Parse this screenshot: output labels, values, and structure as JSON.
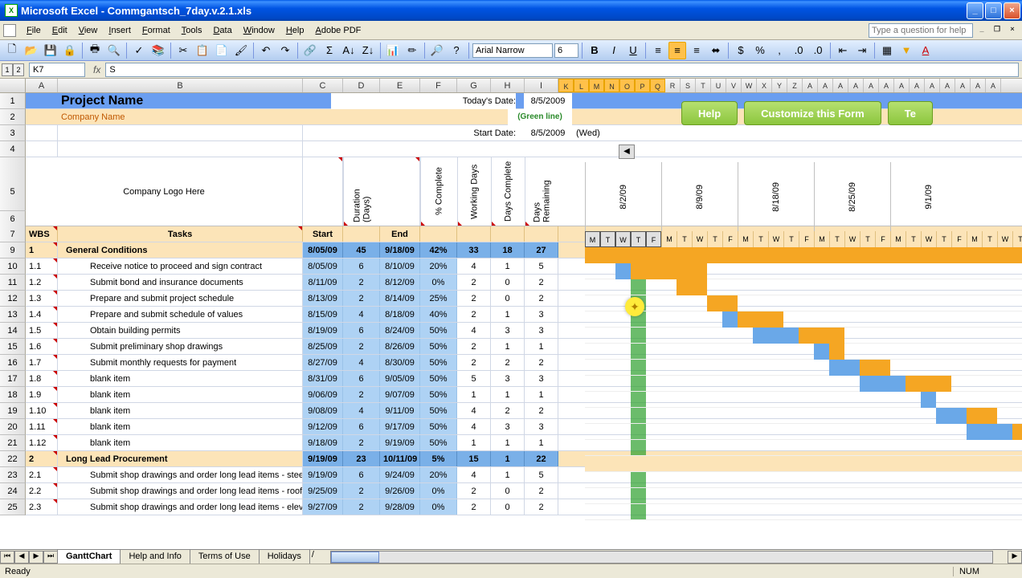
{
  "app": {
    "title": "Microsoft Excel - Commgantsch_7day.v.2.1.xls",
    "help_placeholder": "Type a question for help"
  },
  "menu": [
    "File",
    "Edit",
    "View",
    "Insert",
    "Format",
    "Tools",
    "Data",
    "Window",
    "Help",
    "Adobe PDF"
  ],
  "toolbar2": {
    "font_name": "Arial Narrow",
    "font_size": "6"
  },
  "namebar": {
    "outline": [
      "1",
      "2"
    ],
    "cell_ref": "K7",
    "formula": "S"
  },
  "col_letters_main": [
    "A",
    "B",
    "C",
    "D",
    "E",
    "F",
    "G",
    "H",
    "I"
  ],
  "col_letters_narrow": [
    "K",
    "L",
    "M",
    "N",
    "O",
    "P",
    "Q",
    "R",
    "S",
    "T",
    "U",
    "V",
    "W",
    "X",
    "Y",
    "Z",
    "A",
    "A",
    "A",
    "A",
    "A",
    "A",
    "A",
    "A",
    "A",
    "A",
    "A",
    "A",
    "A"
  ],
  "top": {
    "project": "Project Name",
    "company": "Company Name",
    "logo": "Company Logo Here",
    "today_lbl": "Today's Date:",
    "today": "8/5/2009",
    "green": "(Green line)",
    "start_lbl": "Start Date:",
    "start": "8/5/2009",
    "wed": "(Wed)"
  },
  "buttons": {
    "help": "Help",
    "customize": "Customize this Form",
    "te": "Te"
  },
  "cols": {
    "wbs": "WBS",
    "tasks": "Tasks",
    "start": "Start",
    "dur": "Duration (Days)",
    "end": "End",
    "pct": "% Complete",
    "wd": "Working Days",
    "dc": "Days Complete",
    "dr": "Days Remaining"
  },
  "week_dates": [
    "8/2/09",
    "8/9/09",
    "8/18/09",
    "8/25/09",
    "9/1/09"
  ],
  "dow": [
    "M",
    "T",
    "W",
    "T",
    "F"
  ],
  "rows": [
    {
      "n": 9,
      "g": true,
      "wbs": "1",
      "task": "General Conditions",
      "s": "8/05/09",
      "d": "45",
      "e": "9/18/09",
      "p": "42%",
      "wd": "33",
      "dc": "18",
      "dr": "27"
    },
    {
      "n": 10,
      "wbs": "1.1",
      "task": "Receive notice to proceed and sign contract",
      "s": "8/05/09",
      "d": "6",
      "e": "8/10/09",
      "p": "20%",
      "wd": "4",
      "dc": "1",
      "dr": "5"
    },
    {
      "n": 11,
      "wbs": "1.2",
      "task": "Submit bond and insurance documents",
      "s": "8/11/09",
      "d": "2",
      "e": "8/12/09",
      "p": "0%",
      "wd": "2",
      "dc": "0",
      "dr": "2"
    },
    {
      "n": 12,
      "wbs": "1.3",
      "task": "Prepare and submit project schedule",
      "s": "8/13/09",
      "d": "2",
      "e": "8/14/09",
      "p": "25%",
      "wd": "2",
      "dc": "0",
      "dr": "2"
    },
    {
      "n": 13,
      "wbs": "1.4",
      "task": "Prepare and submit schedule of values",
      "s": "8/15/09",
      "d": "4",
      "e": "8/18/09",
      "p": "40%",
      "wd": "2",
      "dc": "1",
      "dr": "3"
    },
    {
      "n": 14,
      "wbs": "1.5",
      "task": "Obtain building permits",
      "s": "8/19/09",
      "d": "6",
      "e": "8/24/09",
      "p": "50%",
      "wd": "4",
      "dc": "3",
      "dr": "3"
    },
    {
      "n": 15,
      "wbs": "1.6",
      "task": "Submit preliminary shop drawings",
      "s": "8/25/09",
      "d": "2",
      "e": "8/26/09",
      "p": "50%",
      "wd": "2",
      "dc": "1",
      "dr": "1"
    },
    {
      "n": 16,
      "wbs": "1.7",
      "task": "Submit monthly requests for payment",
      "s": "8/27/09",
      "d": "4",
      "e": "8/30/09",
      "p": "50%",
      "wd": "2",
      "dc": "2",
      "dr": "2"
    },
    {
      "n": 17,
      "wbs": "1.8",
      "task": "blank item",
      "s": "8/31/09",
      "d": "6",
      "e": "9/05/09",
      "p": "50%",
      "wd": "5",
      "dc": "3",
      "dr": "3"
    },
    {
      "n": 18,
      "wbs": "1.9",
      "task": "blank item",
      "s": "9/06/09",
      "d": "2",
      "e": "9/07/09",
      "p": "50%",
      "wd": "1",
      "dc": "1",
      "dr": "1"
    },
    {
      "n": 19,
      "wbs": "1.10",
      "task": "blank item",
      "s": "9/08/09",
      "d": "4",
      "e": "9/11/09",
      "p": "50%",
      "wd": "4",
      "dc": "2",
      "dr": "2"
    },
    {
      "n": 20,
      "wbs": "1.11",
      "task": "blank item",
      "s": "9/12/09",
      "d": "6",
      "e": "9/17/09",
      "p": "50%",
      "wd": "4",
      "dc": "3",
      "dr": "3"
    },
    {
      "n": 21,
      "wbs": "1.12",
      "task": "blank item",
      "s": "9/18/09",
      "d": "2",
      "e": "9/19/09",
      "p": "50%",
      "wd": "1",
      "dc": "1",
      "dr": "1"
    },
    {
      "n": 22,
      "g": true,
      "wbs": "2",
      "task": "Long Lead Procurement",
      "s": "9/19/09",
      "d": "23",
      "e": "10/11/09",
      "p": "5%",
      "wd": "15",
      "dc": "1",
      "dr": "22"
    },
    {
      "n": 23,
      "wbs": "2.1",
      "task": "Submit shop drawings and order long lead items - steel",
      "s": "9/19/09",
      "d": "6",
      "e": "9/24/09",
      "p": "20%",
      "wd": "4",
      "dc": "1",
      "dr": "5"
    },
    {
      "n": 24,
      "wbs": "2.2",
      "task": "Submit shop drawings and order long lead items - roofing",
      "s": "9/25/09",
      "d": "2",
      "e": "9/26/09",
      "p": "0%",
      "wd": "2",
      "dc": "0",
      "dr": "2"
    },
    {
      "n": 25,
      "wbs": "2.3",
      "task": "Submit shop drawings and order long lead items - elevator",
      "s": "9/27/09",
      "d": "2",
      "e": "9/28/09",
      "p": "0%",
      "wd": "2",
      "dc": "0",
      "dr": "2"
    }
  ],
  "gantt": {
    "group1": {
      "start": 0,
      "len": 29,
      "type": "full"
    },
    "tasks": [
      {
        "start": 2,
        "b": 1,
        "o": 5
      },
      {
        "start": 6,
        "b": 0,
        "o": 2
      },
      {
        "start": 8,
        "b": 0,
        "o": 2
      },
      {
        "start": 9,
        "b": 1,
        "o": 3
      },
      {
        "start": 11,
        "b": 3,
        "o": 3
      },
      {
        "start": 15,
        "b": 1,
        "o": 1
      },
      {
        "start": 16,
        "b": 2,
        "o": 2
      },
      {
        "start": 18,
        "b": 3,
        "o": 3
      },
      {
        "start": 22,
        "b": 1,
        "o": 0
      },
      {
        "start": 23,
        "b": 2,
        "o": 2
      },
      {
        "start": 25,
        "b": 3,
        "o": 3
      },
      {
        "start": 29,
        "b": 1,
        "o": 0
      }
    ]
  },
  "tabs": [
    "GanttChart",
    "Help and Info",
    "Terms of Use",
    "Holidays"
  ],
  "status": {
    "ready": "Ready",
    "num": "NUM"
  }
}
